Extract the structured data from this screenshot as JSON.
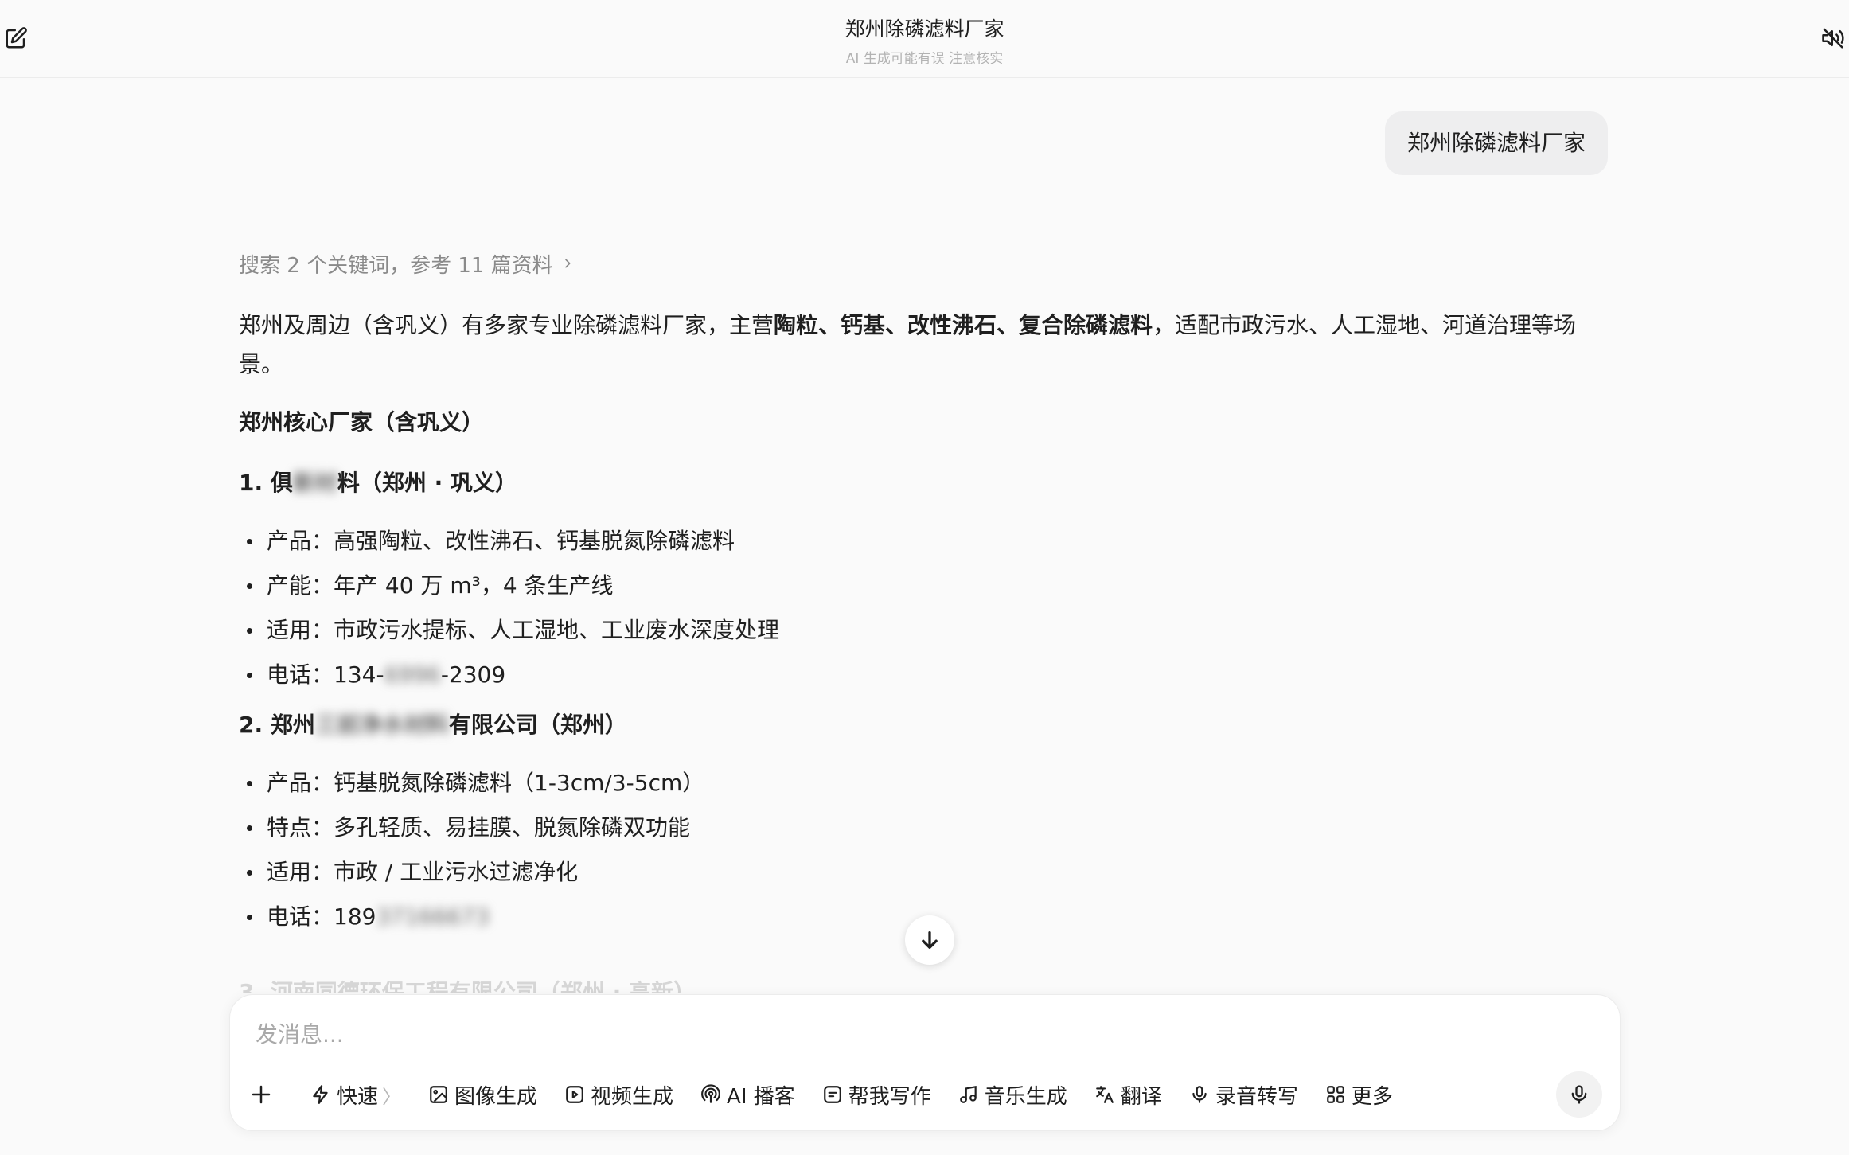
{
  "header": {
    "title": "郑州除磷滤料厂家",
    "subtitle": "AI 生成可能有误 注意核实",
    "left_icon": "edit-icon",
    "right_icon": "speaker-muted-icon"
  },
  "user_message": "郑州除磷滤料厂家",
  "answer": {
    "search_ref": "搜索 2 个关键词，参考 11 篇资料",
    "intro": {
      "p1": "郑州及周边（含巩义）有多家专业除磷滤料厂家，主营",
      "b1": "陶粒、钙基、改性沸石、复合除磷滤料",
      "p2": "，适配市政污水、人工湿地、河道治理等场景。"
    },
    "section_title": "郑州核心厂家（含巩义）",
    "items": [
      {
        "prefix": "1. 俱",
        "blurred": "新材",
        "suffix": "料（郑州 · 巩义）",
        "bullets": [
          {
            "text": "产品：高强陶粒、改性沸石、钙基脱氮除磷滤料"
          },
          {
            "text": "产能：年产 40 万 m³，4 条生产线"
          },
          {
            "text": "适用：市政污水提标、人工湿地、工业废水深度处理"
          },
          {
            "text": "电话：134-",
            "blurred": "6996",
            "after": "-2309"
          }
        ]
      },
      {
        "prefix": "2. 郑州",
        "blurred": "三前净水材料",
        "suffix": "有限公司（郑州）",
        "bullets": [
          {
            "text": "产品：钙基脱氮除磷滤料（1-3cm/3-5cm）"
          },
          {
            "text": "特点：多孔轻质、易挂膜、脱氮除磷双功能"
          },
          {
            "text": "适用：市政 / 工业污水过滤净化"
          },
          {
            "text": "电话：189",
            "blurred": "37166673",
            "after": ""
          }
        ]
      }
    ],
    "next_item_partial": "3. 河南同德环保工程有限公司（郑州 · 高新）"
  },
  "composer": {
    "placeholder": "发消息...",
    "tools": [
      {
        "label": "快速",
        "icon": "lightning-icon"
      },
      {
        "label": "图像生成",
        "icon": "image-icon"
      },
      {
        "label": "视频生成",
        "icon": "video-icon"
      },
      {
        "label": "AI 播客",
        "icon": "podcast-icon"
      },
      {
        "label": "帮我写作",
        "icon": "write-icon"
      },
      {
        "label": "音乐生成",
        "icon": "music-icon"
      },
      {
        "label": "翻译",
        "icon": "translate-icon"
      },
      {
        "label": "录音转写",
        "icon": "mic-icon"
      },
      {
        "label": "更多",
        "icon": "grid-icon"
      }
    ]
  }
}
